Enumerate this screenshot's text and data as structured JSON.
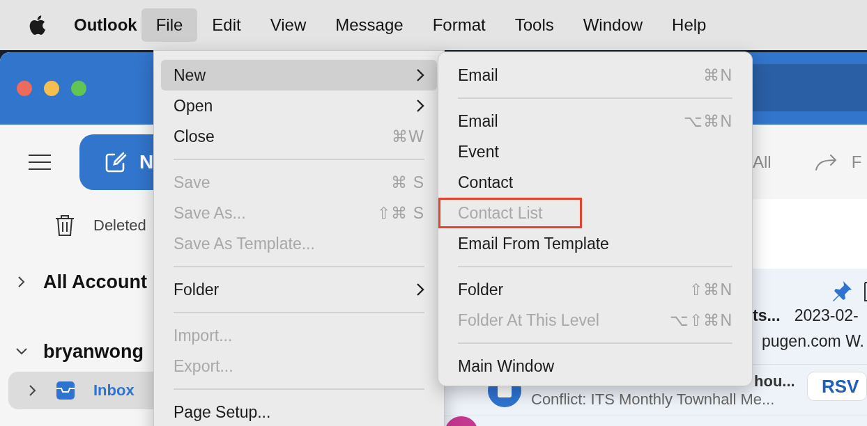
{
  "menu_bar": {
    "app_name": "Outlook",
    "menus": [
      {
        "label": "File",
        "selected": true
      },
      {
        "label": "Edit",
        "selected": false
      },
      {
        "label": "View",
        "selected": false
      },
      {
        "label": "Message",
        "selected": false
      },
      {
        "label": "Format",
        "selected": false
      },
      {
        "label": "Tools",
        "selected": false
      },
      {
        "label": "Window",
        "selected": false
      },
      {
        "label": "Help",
        "selected": false
      }
    ]
  },
  "toolbar": {
    "new_button": "N",
    "reply_all": "All",
    "forward": "F"
  },
  "sidebar": {
    "items": [
      {
        "kind": "folder",
        "label": "Deleted",
        "selected": false
      },
      {
        "kind": "group",
        "label": "All Account",
        "expanded": false
      },
      {
        "kind": "account",
        "label": "bryanwong",
        "expanded": true
      },
      {
        "kind": "inbox",
        "label": "Inbox",
        "selected": true
      }
    ]
  },
  "messages": [
    {
      "kind": "pinned",
      "subject": "ts...",
      "date": "2023-02-",
      "preview": "pugen.com W."
    },
    {
      "kind": "invite",
      "sender": "hou...",
      "subject": "Conflict: ITS Monthly Townhall Me...",
      "action": "RSV"
    }
  ],
  "file_menu": {
    "items": [
      {
        "kind": "item",
        "label": "New",
        "has_submenu": true,
        "disabled": false,
        "selected": true
      },
      {
        "kind": "item",
        "label": "Open",
        "has_submenu": true,
        "disabled": false,
        "selected": false
      },
      {
        "kind": "item",
        "label": "Close",
        "shortcut": "⌘W",
        "has_submenu": false,
        "disabled": false,
        "selected": false
      },
      {
        "kind": "separator"
      },
      {
        "kind": "item",
        "label": "Save",
        "shortcut": "⌘ S",
        "disabled": true,
        "selected": false
      },
      {
        "kind": "item",
        "label": "Save As...",
        "shortcut": "⇧⌘ S",
        "disabled": true,
        "selected": false
      },
      {
        "kind": "item",
        "label": "Save As Template...",
        "disabled": true,
        "selected": false
      },
      {
        "kind": "separator"
      },
      {
        "kind": "item",
        "label": "Folder",
        "has_submenu": true,
        "disabled": false,
        "selected": false
      },
      {
        "kind": "separator"
      },
      {
        "kind": "item",
        "label": "Import...",
        "disabled": true,
        "selected": false
      },
      {
        "kind": "item",
        "label": "Export...",
        "disabled": true,
        "selected": false
      },
      {
        "kind": "separator"
      },
      {
        "kind": "item",
        "label": "Page Setup...",
        "disabled": false,
        "selected": false
      }
    ]
  },
  "new_submenu": {
    "items": [
      {
        "kind": "item",
        "label": "Email",
        "shortcut": "⌘N",
        "disabled": false,
        "annotated": false
      },
      {
        "kind": "separator"
      },
      {
        "kind": "item",
        "label": "Email",
        "shortcut": "⌥⌘N",
        "disabled": false,
        "annotated": false
      },
      {
        "kind": "item",
        "label": "Event",
        "disabled": false,
        "annotated": false
      },
      {
        "kind": "item",
        "label": "Contact",
        "disabled": false,
        "annotated": false
      },
      {
        "kind": "item",
        "label": "Contact List",
        "disabled": true,
        "annotated": true
      },
      {
        "kind": "item",
        "label": "Email From Template",
        "disabled": false,
        "annotated": false
      },
      {
        "kind": "separator"
      },
      {
        "kind": "item",
        "label": "Folder",
        "shortcut": "⇧⌘N",
        "disabled": false,
        "annotated": false
      },
      {
        "kind": "item",
        "label": "Folder At This Level",
        "shortcut": "⌥⇧⌘N",
        "disabled": true,
        "annotated": false
      },
      {
        "kind": "separator"
      },
      {
        "kind": "item",
        "label": "Main Window",
        "disabled": false,
        "annotated": false
      }
    ]
  }
}
